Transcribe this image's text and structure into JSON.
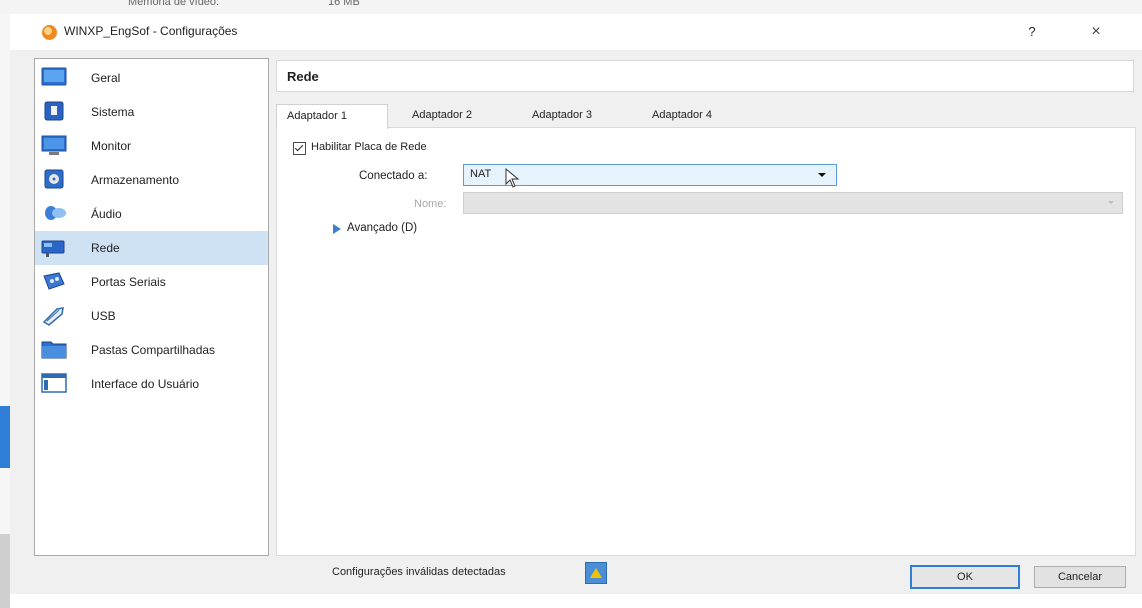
{
  "background": {
    "memory_label": "Memória de vídeo:",
    "memory_value": "16 MB"
  },
  "window": {
    "title": "WINXP_EngSof - Configurações",
    "help_label": "?",
    "close_label": "×"
  },
  "sidebar": {
    "items": [
      {
        "label": "Geral",
        "icon": "general-icon"
      },
      {
        "label": "Sistema",
        "icon": "system-icon"
      },
      {
        "label": "Monitor",
        "icon": "monitor-icon"
      },
      {
        "label": "Armazenamento",
        "icon": "storage-icon"
      },
      {
        "label": "Áudio",
        "icon": "audio-icon"
      },
      {
        "label": "Rede",
        "icon": "network-icon",
        "selected": true
      },
      {
        "label": "Portas Seriais",
        "icon": "serial-ports-icon"
      },
      {
        "label": "USB",
        "icon": "usb-icon"
      },
      {
        "label": "Pastas Compartilhadas",
        "icon": "shared-folders-icon"
      },
      {
        "label": "Interface do Usuário",
        "icon": "user-interface-icon"
      }
    ]
  },
  "main": {
    "title": "Rede",
    "tabs": [
      {
        "label": "Adaptador 1",
        "active": true
      },
      {
        "label": "Adaptador 2"
      },
      {
        "label": "Adaptador 3"
      },
      {
        "label": "Adaptador 4"
      }
    ],
    "enable_checkbox": {
      "label": "Habilitar Placa de Rede",
      "checked": true
    },
    "connected_to": {
      "label": "Conectado a:",
      "value": "NAT"
    },
    "name": {
      "label": "Nome:",
      "value": "",
      "disabled": true
    },
    "advanced": {
      "label": "Avançado (D)",
      "expanded": false
    }
  },
  "footer": {
    "warning_text": "Configurações inválidas detectadas",
    "ok_label": "OK",
    "cancel_label": "Cancelar"
  },
  "colors": {
    "selection": "#cfe2f4",
    "accent": "#2f7fd6"
  }
}
